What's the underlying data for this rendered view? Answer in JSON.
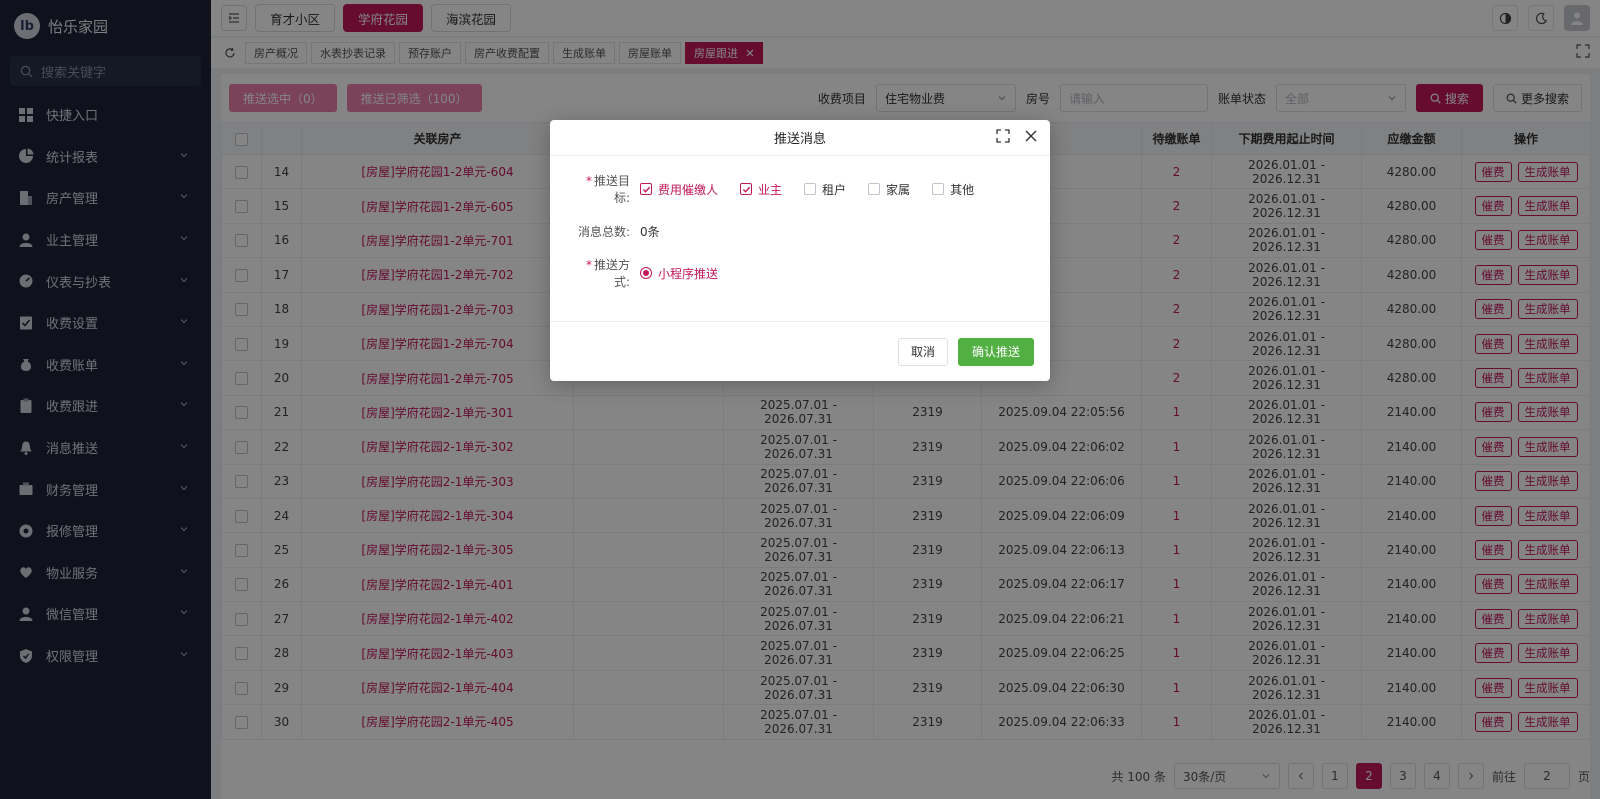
{
  "brand": {
    "name": "怡乐家园",
    "logo_text": "lb"
  },
  "sidebar": {
    "search_placeholder": "搜索关键字",
    "items": [
      {
        "label": "快捷入口",
        "icon": "grid-icon",
        "chevron": false
      },
      {
        "label": "统计报表",
        "icon": "pie-chart-icon",
        "chevron": true
      },
      {
        "label": "房产管理",
        "icon": "building-icon",
        "chevron": true
      },
      {
        "label": "业主管理",
        "icon": "user-icon",
        "chevron": true
      },
      {
        "label": "仪表与抄表",
        "icon": "gauge-icon",
        "chevron": true
      },
      {
        "label": "收费设置",
        "icon": "settings-doc-icon",
        "chevron": true
      },
      {
        "label": "收费账单",
        "icon": "money-bag-icon",
        "chevron": true
      },
      {
        "label": "收费跟进",
        "icon": "clipboard-icon",
        "chevron": true
      },
      {
        "label": "消息推送",
        "icon": "bell-icon",
        "chevron": true
      },
      {
        "label": "财务管理",
        "icon": "finance-icon",
        "chevron": true
      },
      {
        "label": "报修管理",
        "icon": "repair-icon",
        "chevron": true
      },
      {
        "label": "物业服务",
        "icon": "heart-hand-icon",
        "chevron": true
      },
      {
        "label": "微信管理",
        "icon": "user-icon",
        "chevron": true
      },
      {
        "label": "权限管理",
        "icon": "shield-icon",
        "chevron": true
      }
    ]
  },
  "topbar": {
    "communities": [
      "育才小区",
      "学府花园",
      "海滨花园"
    ],
    "active_community": 1
  },
  "pagetabs": {
    "tabs": [
      "房产概况",
      "水表抄表记录",
      "预存账户",
      "房产收费配置",
      "生成账单",
      "房屋账单",
      "房屋跟进"
    ],
    "active": 6
  },
  "toolbar": {
    "push_selected": "推送选中（0）",
    "push_filtered": "推送已筛选（100）",
    "fee_item_label": "收费项目",
    "fee_item_value": "住宅物业费",
    "room_label": "房号",
    "room_placeholder": "请输入",
    "bill_status_label": "账单状态",
    "bill_status_value": "全部",
    "search_btn": "搜索",
    "more_search_btn": "更多搜索"
  },
  "table": {
    "headers": [
      "",
      "",
      "关联房产",
      "",
      "",
      "",
      "",
      "待缴账单",
      "下期费用起止时间",
      "应缴金额",
      "操作"
    ],
    "op_labels": [
      "催费",
      "生成账单"
    ],
    "rows": [
      [
        "14",
        "[房屋]学府花园1-2单元-604",
        "",
        "",
        "",
        "",
        "2",
        "2026.01.01 - 2026.12.31",
        "4280.00"
      ],
      [
        "15",
        "[房屋]学府花园1-2单元-605",
        "",
        "",
        "",
        "",
        "2",
        "2026.01.01 - 2026.12.31",
        "4280.00"
      ],
      [
        "16",
        "[房屋]学府花园1-2单元-701",
        "",
        "",
        "",
        "",
        "2",
        "2026.01.01 - 2026.12.31",
        "4280.00"
      ],
      [
        "17",
        "[房屋]学府花园1-2单元-702",
        "",
        "",
        "",
        "",
        "2",
        "2026.01.01 - 2026.12.31",
        "4280.00"
      ],
      [
        "18",
        "[房屋]学府花园1-2单元-703",
        "",
        "",
        "",
        "",
        "2",
        "2026.01.01 - 2026.12.31",
        "4280.00"
      ],
      [
        "19",
        "[房屋]学府花园1-2单元-704",
        "",
        "",
        "",
        "",
        "2",
        "2026.01.01 - 2026.12.31",
        "4280.00"
      ],
      [
        "20",
        "[房屋]学府花园1-2单元-705",
        "",
        "",
        "",
        "",
        "2",
        "2026.01.01 - 2026.12.31",
        "4280.00"
      ],
      [
        "21",
        "[房屋]学府花园2-1单元-301",
        "",
        "2025.07.01 - 2026.07.31",
        "2319",
        "2025.09.04 22:05:56",
        "1",
        "2026.01.01 - 2026.12.31",
        "2140.00"
      ],
      [
        "22",
        "[房屋]学府花园2-1单元-302",
        "",
        "2025.07.01 - 2026.07.31",
        "2319",
        "2025.09.04 22:06:02",
        "1",
        "2026.01.01 - 2026.12.31",
        "2140.00"
      ],
      [
        "23",
        "[房屋]学府花园2-1单元-303",
        "",
        "2025.07.01 - 2026.07.31",
        "2319",
        "2025.09.04 22:06:06",
        "1",
        "2026.01.01 - 2026.12.31",
        "2140.00"
      ],
      [
        "24",
        "[房屋]学府花园2-1单元-304",
        "",
        "2025.07.01 - 2026.07.31",
        "2319",
        "2025.09.04 22:06:09",
        "1",
        "2026.01.01 - 2026.12.31",
        "2140.00"
      ],
      [
        "25",
        "[房屋]学府花园2-1单元-305",
        "",
        "2025.07.01 - 2026.07.31",
        "2319",
        "2025.09.04 22:06:13",
        "1",
        "2026.01.01 - 2026.12.31",
        "2140.00"
      ],
      [
        "26",
        "[房屋]学府花园2-1单元-401",
        "",
        "2025.07.01 - 2026.07.31",
        "2319",
        "2025.09.04 22:06:17",
        "1",
        "2026.01.01 - 2026.12.31",
        "2140.00"
      ],
      [
        "27",
        "[房屋]学府花园2-1单元-402",
        "",
        "2025.07.01 - 2026.07.31",
        "2319",
        "2025.09.04 22:06:21",
        "1",
        "2026.01.01 - 2026.12.31",
        "2140.00"
      ],
      [
        "28",
        "[房屋]学府花园2-1单元-403",
        "",
        "2025.07.01 - 2026.07.31",
        "2319",
        "2025.09.04 22:06:25",
        "1",
        "2026.01.01 - 2026.12.31",
        "2140.00"
      ],
      [
        "29",
        "[房屋]学府花园2-1单元-404",
        "",
        "2025.07.01 - 2026.07.31",
        "2319",
        "2025.09.04 22:06:30",
        "1",
        "2026.01.01 - 2026.12.31",
        "2140.00"
      ],
      [
        "30",
        "[房屋]学府花园2-1单元-405",
        "",
        "2025.07.01 - 2026.07.31",
        "2319",
        "2025.09.04 22:06:33",
        "1",
        "2026.01.01 - 2026.12.31",
        "2140.00"
      ]
    ]
  },
  "pager": {
    "total": "共 100 条",
    "page_size": "30条/页",
    "pages": [
      "1",
      "2",
      "3",
      "4"
    ],
    "current": 1,
    "goto_label": "前往",
    "goto_value": "2",
    "page_suffix": "页"
  },
  "modal": {
    "title": "推送消息",
    "target_label": "推送目标:",
    "targets": [
      {
        "label": "费用催缴人",
        "checked": true
      },
      {
        "label": "业主",
        "checked": true
      },
      {
        "label": "租户",
        "checked": false
      },
      {
        "label": "家属",
        "checked": false
      },
      {
        "label": "其他",
        "checked": false
      }
    ],
    "total_label": "消息总数:",
    "total_value": "0条",
    "method_label": "推送方式:",
    "method_value": "小程序推送",
    "cancel": "取消",
    "confirm": "确认推送"
  },
  "colors": {
    "accent": "#c2185b",
    "accent_light": "#ea80ab",
    "confirm": "#52b043",
    "sidebar_bg": "#1d2239"
  }
}
